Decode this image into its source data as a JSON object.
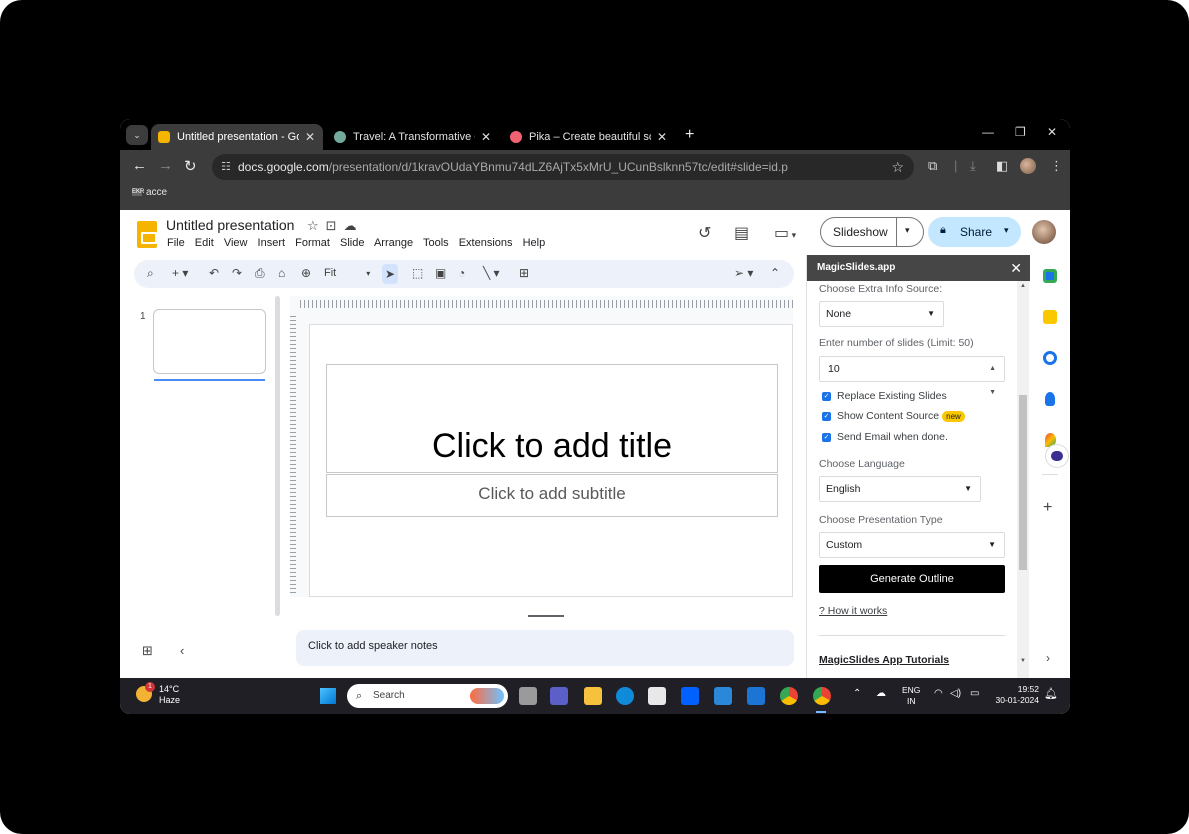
{
  "browser": {
    "tabs": [
      {
        "title": "Untitled presentation - Google",
        "active": true,
        "favicon_color": "#f4b400"
      },
      {
        "title": "Travel: A Transformative Odysse",
        "active": false,
        "favicon_color": "#74aa9c"
      },
      {
        "title": "Pika – Create beautiful screensh",
        "active": false,
        "favicon_color": "#f06272"
      }
    ],
    "tab_close": "✕",
    "new_tab": "+",
    "url_host": "docs.google.com",
    "url_path": "/presentation/d/1kravOUdaYBnmu74dLZ6AjTx5xMrU_UCunBslknn57tc/edit#slide=id.p",
    "bookmark_label": "acce",
    "bookmark_badge": "EKR"
  },
  "slides": {
    "doc_title": "Untitled presentation",
    "menu": [
      "File",
      "Edit",
      "View",
      "Insert",
      "Format",
      "Slide",
      "Arrange",
      "Tools",
      "Extensions",
      "Help"
    ],
    "slideshow_label": "Slideshow",
    "share_label": "Share",
    "zoom_label": "Fit",
    "slide_number": "1",
    "title_placeholder": "Click to add title",
    "subtitle_placeholder": "Click to add subtitle",
    "speaker_notes_placeholder": "Click to add speaker notes"
  },
  "panel": {
    "title": "MagicSlides.app",
    "extra_info_label": "Choose Extra Info Source:",
    "extra_info_value": "None",
    "slides_count_label": "Enter number of slides (Limit: 50)",
    "slides_count_value": "10",
    "checkboxes": [
      {
        "label": "Replace Existing Slides",
        "checked": true
      },
      {
        "label": "Show Content Source",
        "checked": true,
        "badge": "new"
      },
      {
        "label": "Send Email when done.",
        "checked": true
      }
    ],
    "language_label": "Choose Language",
    "language_value": "English",
    "type_label": "Choose Presentation Type",
    "type_value": "Custom",
    "generate_label": "Generate Outline",
    "how_link": "? How it works",
    "tutorials_link": "MagicSlides App Tutorials"
  },
  "taskbar": {
    "temperature": "14°C",
    "weather": "Haze",
    "weather_badge": "1",
    "search_label": "Search",
    "lang_line1": "ENG",
    "lang_line2": "IN",
    "time": "19:52",
    "date": "30-01-2024"
  },
  "colors": {
    "slides_yellow": "#f4b400",
    "share_bg": "#c2e7ff",
    "panel_header": "#464646",
    "generate_bg": "#000000",
    "checkbox_blue": "#1a73e8",
    "new_badge": "#f9c800"
  }
}
